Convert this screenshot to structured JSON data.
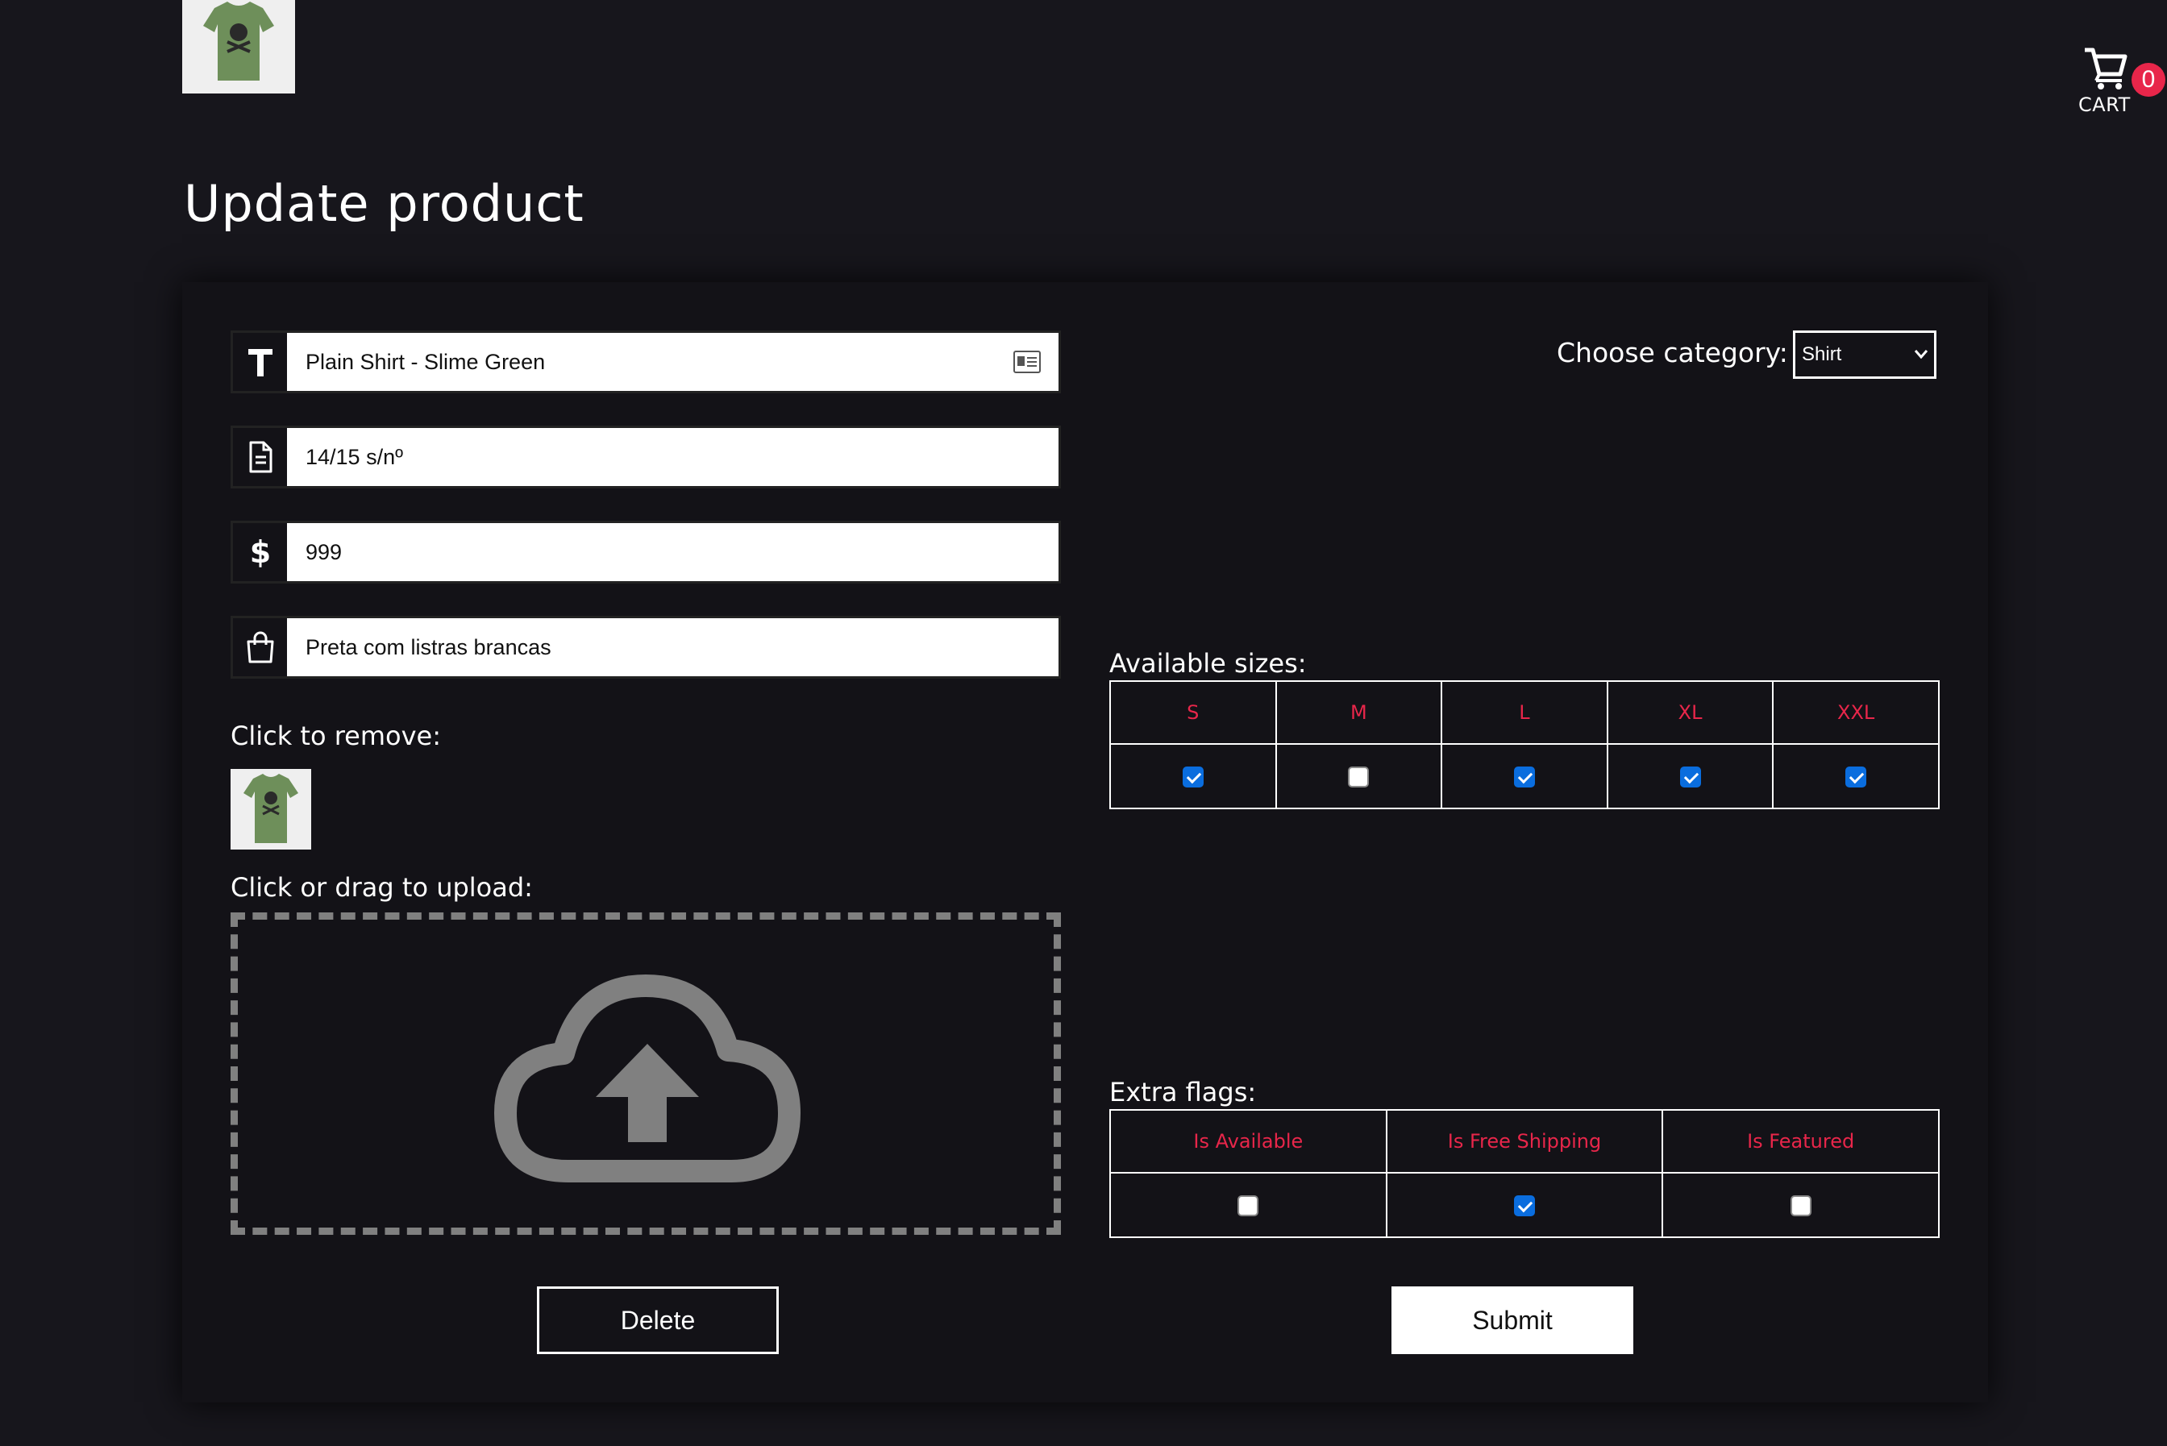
{
  "header": {
    "cart_label": "CART",
    "cart_count": "0"
  },
  "page_title": "Update product",
  "form": {
    "fields": [
      {
        "icon": "title-t-icon",
        "value": "Plain Shirt - Slime Green"
      },
      {
        "icon": "document-icon",
        "value": "14/15 s/nº"
      },
      {
        "icon": "dollar-icon",
        "value": "999"
      },
      {
        "icon": "shopping-bag-icon",
        "value": "Preta com listras brancas"
      }
    ],
    "remove_label": "Click to remove:",
    "upload_label": "Click or drag to upload:",
    "delete_label": "Delete",
    "submit_label": "Submit"
  },
  "category": {
    "label": "Choose category:",
    "selected": "Shirt"
  },
  "sizes": {
    "label": "Available sizes:",
    "items": [
      {
        "name": "S",
        "checked": true
      },
      {
        "name": "M",
        "checked": false
      },
      {
        "name": "L",
        "checked": true
      },
      {
        "name": "XL",
        "checked": true
      },
      {
        "name": "XXL",
        "checked": true
      }
    ]
  },
  "flags": {
    "label": "Extra flags:",
    "items": [
      {
        "name": "Is Available",
        "checked": false
      },
      {
        "name": "Is Free Shipping",
        "checked": true
      },
      {
        "name": "Is Featured",
        "checked": false
      }
    ]
  },
  "colors": {
    "background": "#17161c",
    "panel": "#131217",
    "accent": "#e8264a",
    "checkbox_on": "#0a6dde",
    "upload_icon": "#808080"
  }
}
